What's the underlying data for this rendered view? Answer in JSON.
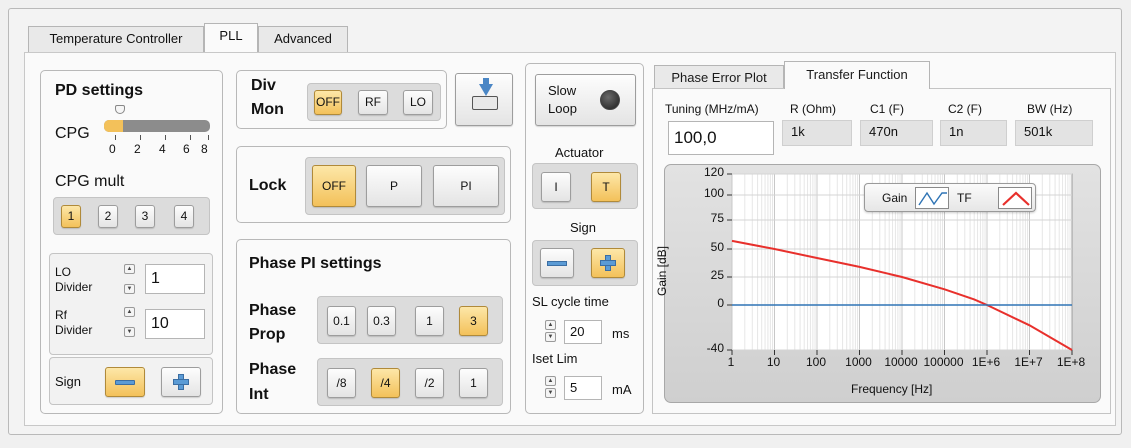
{
  "tabs": [
    "Temperature Controller",
    "PLL",
    "Advanced"
  ],
  "active_tab": "PLL",
  "pd_settings": {
    "title": "PD settings",
    "cpg_label": "CPG",
    "cpg_value": 0,
    "cpg_ticks": [
      "0",
      "2",
      "4",
      "6",
      "8"
    ],
    "cpg_mult_label": "CPG mult",
    "cpg_mult_options": [
      "1",
      "2",
      "3",
      "4"
    ],
    "cpg_mult_selected": "1",
    "lo_divider_label_1": "LO",
    "lo_divider_label_2": "Divider",
    "lo_divider_value": "1",
    "rf_divider_label_1": "Rf",
    "rf_divider_label_2": "Divider",
    "rf_divider_value": "10",
    "sign_label": "Sign"
  },
  "div_mon": {
    "label_1": "Div",
    "label_2": "Mon",
    "options": [
      "OFF",
      "RF",
      "LO"
    ],
    "selected": "OFF"
  },
  "lock": {
    "label": "Lock",
    "options": [
      "OFF",
      "P",
      "PI"
    ],
    "selected": "OFF"
  },
  "phase_pi": {
    "title": "Phase PI settings",
    "prop_label_1": "Phase",
    "prop_label_2": "Prop",
    "prop_options": [
      "0.1",
      "0.3",
      "1",
      "3"
    ],
    "prop_selected": "3",
    "int_label_1": "Phase",
    "int_label_2": "Int",
    "int_options": [
      "/8",
      "/4",
      "/2",
      "1"
    ],
    "int_selected": "/4"
  },
  "slow_loop": {
    "label_1": "Slow",
    "label_2": "Loop",
    "actuator_label": "Actuator",
    "actuator_options": [
      "I",
      "T"
    ],
    "actuator_selected": "T",
    "sign_label": "Sign",
    "sl_cycle_label": "SL cycle time",
    "sl_cycle_value": "20",
    "sl_cycle_unit": "ms",
    "iset_label": "Iset Lim",
    "iset_value": "5",
    "iset_unit": "mA"
  },
  "right_tabs": [
    "Phase Error Plot",
    "Transfer Function"
  ],
  "right_active_tab": "Transfer Function",
  "params": {
    "tuning_label": "Tuning (MHz/mA)",
    "tuning_value": "100,0",
    "r_label": "R (Ohm)",
    "r_value": "1k",
    "c1_label": "C1 (F)",
    "c1_value": "470n",
    "c2_label": "C2 (F)",
    "c2_value": "1n",
    "bw_label": "BW (Hz)",
    "bw_value": "501k"
  },
  "legend": {
    "gain_label": "Gain",
    "tf_label": "TF"
  },
  "colors": {
    "accent_on": "#f3c15a",
    "gain_series": "#2f74b5",
    "tf_series": "#e8302c"
  },
  "chart_data": {
    "type": "line",
    "title": "",
    "xlabel": "Frequency [Hz]",
    "ylabel": "Gain [dB]",
    "x_scale": "log",
    "xlim": [
      1,
      100000000
    ],
    "ylim": [
      -40,
      120
    ],
    "x_tick_labels": [
      "1",
      "10",
      "100",
      "1000",
      "10000",
      "100000",
      "1E+6",
      "1E+7",
      "1E+8"
    ],
    "y_tick_labels": [
      "120",
      "100",
      "75",
      "50",
      "25",
      "0",
      "-40"
    ],
    "grid": true,
    "legend_position": "top-right",
    "series": [
      {
        "name": "TF",
        "x": [
          1,
          10,
          100,
          1000,
          10000,
          100000,
          500000,
          1000000,
          10000000,
          100000000
        ],
        "y": [
          57,
          50,
          42,
          34,
          25,
          14,
          5,
          0,
          -18,
          -40
        ]
      },
      {
        "name": "Gain",
        "x": [
          1,
          100000000
        ],
        "y": [
          0,
          0
        ]
      }
    ]
  }
}
